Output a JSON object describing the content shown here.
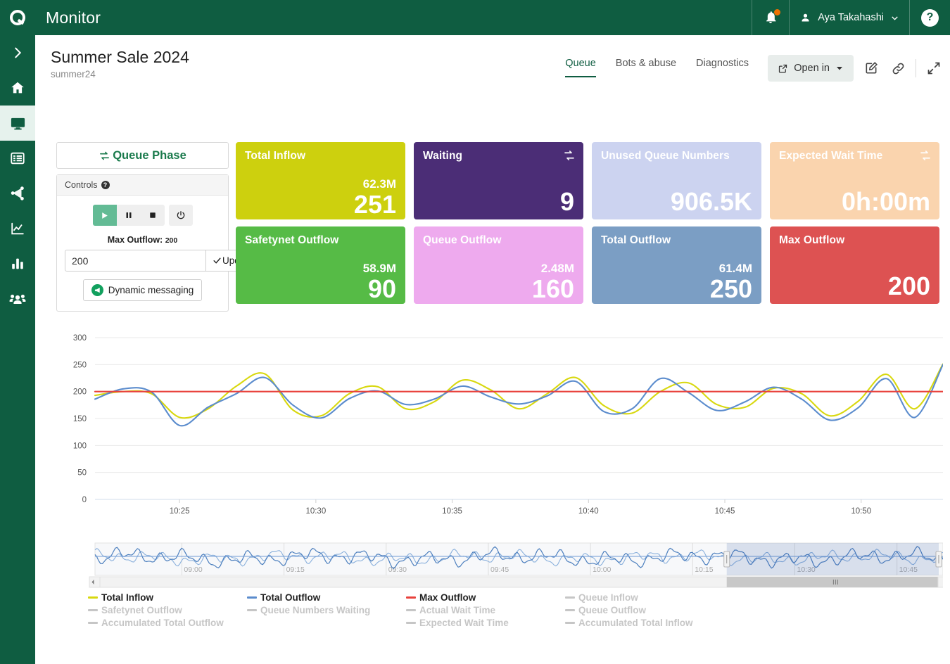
{
  "app": {
    "title": "Monitor",
    "logo_icon": "q-logo-icon",
    "notifications_icon": "bell-icon",
    "user_name": "Aya Takahashi",
    "user_icon": "person-icon",
    "user_chevron_icon": "chevron-down-icon",
    "help_label": "?",
    "help_icon": "help-icon"
  },
  "sidebar": {
    "items": [
      {
        "name": "expand",
        "icon": "chevron-right-icon",
        "active": false
      },
      {
        "name": "home",
        "icon": "home-icon",
        "active": false
      },
      {
        "name": "monitor",
        "icon": "monitor-icon",
        "active": true
      },
      {
        "name": "list",
        "icon": "list-icon",
        "active": false
      },
      {
        "name": "share",
        "icon": "share-network-icon",
        "active": false
      },
      {
        "name": "trends",
        "icon": "line-chart-icon",
        "active": false
      },
      {
        "name": "reports",
        "icon": "bar-chart-icon",
        "active": false
      },
      {
        "name": "users",
        "icon": "people-icon",
        "active": false
      }
    ]
  },
  "header": {
    "title": "Summer Sale 2024",
    "subtitle": "summer24",
    "tabs": [
      {
        "label": "Queue",
        "active": true
      },
      {
        "label": "Bots & abuse",
        "active": false
      },
      {
        "label": "Diagnostics",
        "active": false
      }
    ],
    "open_in_label": "Open in",
    "open_in_icon": "external-link-icon",
    "open_in_chevron": "chevron-down-icon",
    "edit_icon": "edit-pencil-icon",
    "link_icon": "link-chain-icon",
    "expand_icon": "fullscreen-expand-icon"
  },
  "controls": {
    "phase_label": "Queue Phase",
    "phase_icon": "exchange-arrows-icon",
    "panel_title": "Controls",
    "panel_help_icon": "help-icon",
    "buttons": [
      {
        "name": "play",
        "icon": "play-icon",
        "active": true
      },
      {
        "name": "pause",
        "icon": "pause-icon",
        "active": false
      },
      {
        "name": "stop",
        "icon": "stop-icon",
        "active": false
      },
      {
        "name": "power",
        "icon": "power-icon",
        "active": false
      }
    ],
    "max_outflow_label": "Max Outflow:",
    "max_outflow_value": "200",
    "input_value": "200",
    "input_placeholder": "200",
    "update_label": "Update",
    "update_icon": "check-icon",
    "dynamic_messaging_label": "Dynamic messaging",
    "dynamic_messaging_icon": "megaphone-icon"
  },
  "tiles": [
    {
      "title": "Total Inflow",
      "sub": "62.3M",
      "main": "251",
      "bg": "#cdd00e",
      "refresh": false
    },
    {
      "title": "Waiting",
      "sub": "",
      "main": "9",
      "bg": "#4b2d76",
      "refresh": true
    },
    {
      "title": "Unused Queue Numbers",
      "sub": "",
      "main": "906.5K",
      "bg": "#ccd3f0",
      "refresh": false
    },
    {
      "title": "Expected Wait Time",
      "sub": "",
      "main": "0h:00m",
      "bg": "#fad4ae",
      "refresh": true
    },
    {
      "title": "Safetynet Outflow",
      "sub": "58.9M",
      "main": "90",
      "bg": "#56bb46",
      "refresh": false
    },
    {
      "title": "Queue Outflow",
      "sub": "2.48M",
      "main": "160",
      "bg": "#eeaaee",
      "refresh": false
    },
    {
      "title": "Total Outflow",
      "sub": "61.4M",
      "main": "250",
      "bg": "#7b9ec4",
      "refresh": false
    },
    {
      "title": "Max Outflow",
      "sub": "",
      "main": "200",
      "bg": "#dd5252",
      "refresh": false
    }
  ],
  "legend": [
    {
      "label": "Total Inflow",
      "on": true,
      "color": "#d8d80f"
    },
    {
      "label": "Total Outflow",
      "on": true,
      "color": "#5b8ccd"
    },
    {
      "label": "Max Outflow",
      "on": true,
      "color": "#e8413c"
    },
    {
      "label": "Queue Inflow",
      "on": false,
      "color": "#c6c6c6"
    },
    {
      "label": "Queue Outflow",
      "on": false,
      "color": "#c6c6c6"
    },
    {
      "label": "Safetynet Outflow",
      "on": false,
      "color": "#c6c6c6"
    },
    {
      "label": "Queue Numbers Waiting",
      "on": false,
      "color": "#c6c6c6"
    },
    {
      "label": "Actual Wait Time",
      "on": false,
      "color": "#c6c6c6"
    },
    {
      "label": "Expected Wait Time",
      "on": false,
      "color": "#c6c6c6"
    },
    {
      "label": "Accumulated Total Inflow",
      "on": false,
      "color": "#c6c6c6"
    },
    {
      "label": "Accumulated Total Outflow",
      "on": false,
      "color": "#c6c6c6"
    }
  ],
  "chart_data": {
    "type": "line",
    "title": "",
    "xlabel": "",
    "ylabel": "",
    "ylim": [
      0,
      300
    ],
    "yticks": [
      0,
      50,
      100,
      150,
      200,
      250,
      300
    ],
    "xticks": [
      "10:25",
      "10:30",
      "10:35",
      "10:40",
      "10:45",
      "10:50"
    ],
    "grid": true,
    "legend_position": "bottom",
    "x": [
      "10:22",
      "10:23",
      "10:24",
      "10:25",
      "10:26",
      "10:27",
      "10:28",
      "10:29",
      "10:30",
      "10:31",
      "10:32",
      "10:33",
      "10:34",
      "10:35",
      "10:36",
      "10:37",
      "10:38",
      "10:39",
      "10:40",
      "10:41",
      "10:42",
      "10:43",
      "10:44",
      "10:45",
      "10:46",
      "10:47",
      "10:48",
      "10:49",
      "10:50",
      "10:51",
      "10:52"
    ],
    "series": [
      {
        "name": "Total Inflow",
        "color": "#d8d80f",
        "values": [
          193,
          200,
          196,
          152,
          168,
          210,
          233,
          166,
          155,
          196,
          209,
          168,
          181,
          221,
          203,
          168,
          196,
          226,
          174,
          160,
          200,
          216,
          176,
          171,
          206,
          196,
          155,
          182,
          232,
          168,
          251
        ]
      },
      {
        "name": "Total Outflow",
        "color": "#5b8ccd",
        "values": [
          186,
          205,
          199,
          137,
          171,
          196,
          226,
          175,
          151,
          187,
          201,
          176,
          186,
          210,
          190,
          177,
          192,
          219,
          163,
          168,
          224,
          198,
          165,
          181,
          208,
          186,
          147,
          170,
          224,
          152,
          250
        ]
      },
      {
        "name": "Max Outflow",
        "color": "#e8413c",
        "values": [
          200,
          200,
          200,
          200,
          200,
          200,
          200,
          200,
          200,
          200,
          200,
          200,
          200,
          200,
          200,
          200,
          200,
          200,
          200,
          200,
          200,
          200,
          200,
          200,
          200,
          200,
          200,
          200,
          200,
          200,
          200
        ]
      }
    ]
  },
  "navigator": {
    "ticks": [
      "09:00",
      "09:15",
      "09:30",
      "09:45",
      "10:00",
      "10:15",
      "10:30",
      "10:45"
    ],
    "selection_start_pct": 74.5,
    "selection_end_pct": 99.5,
    "scroll_left_icon": "chevron-left-icon",
    "scroll_right_icon": "chevron-right-icon",
    "grip_icon": "grip-icon"
  }
}
